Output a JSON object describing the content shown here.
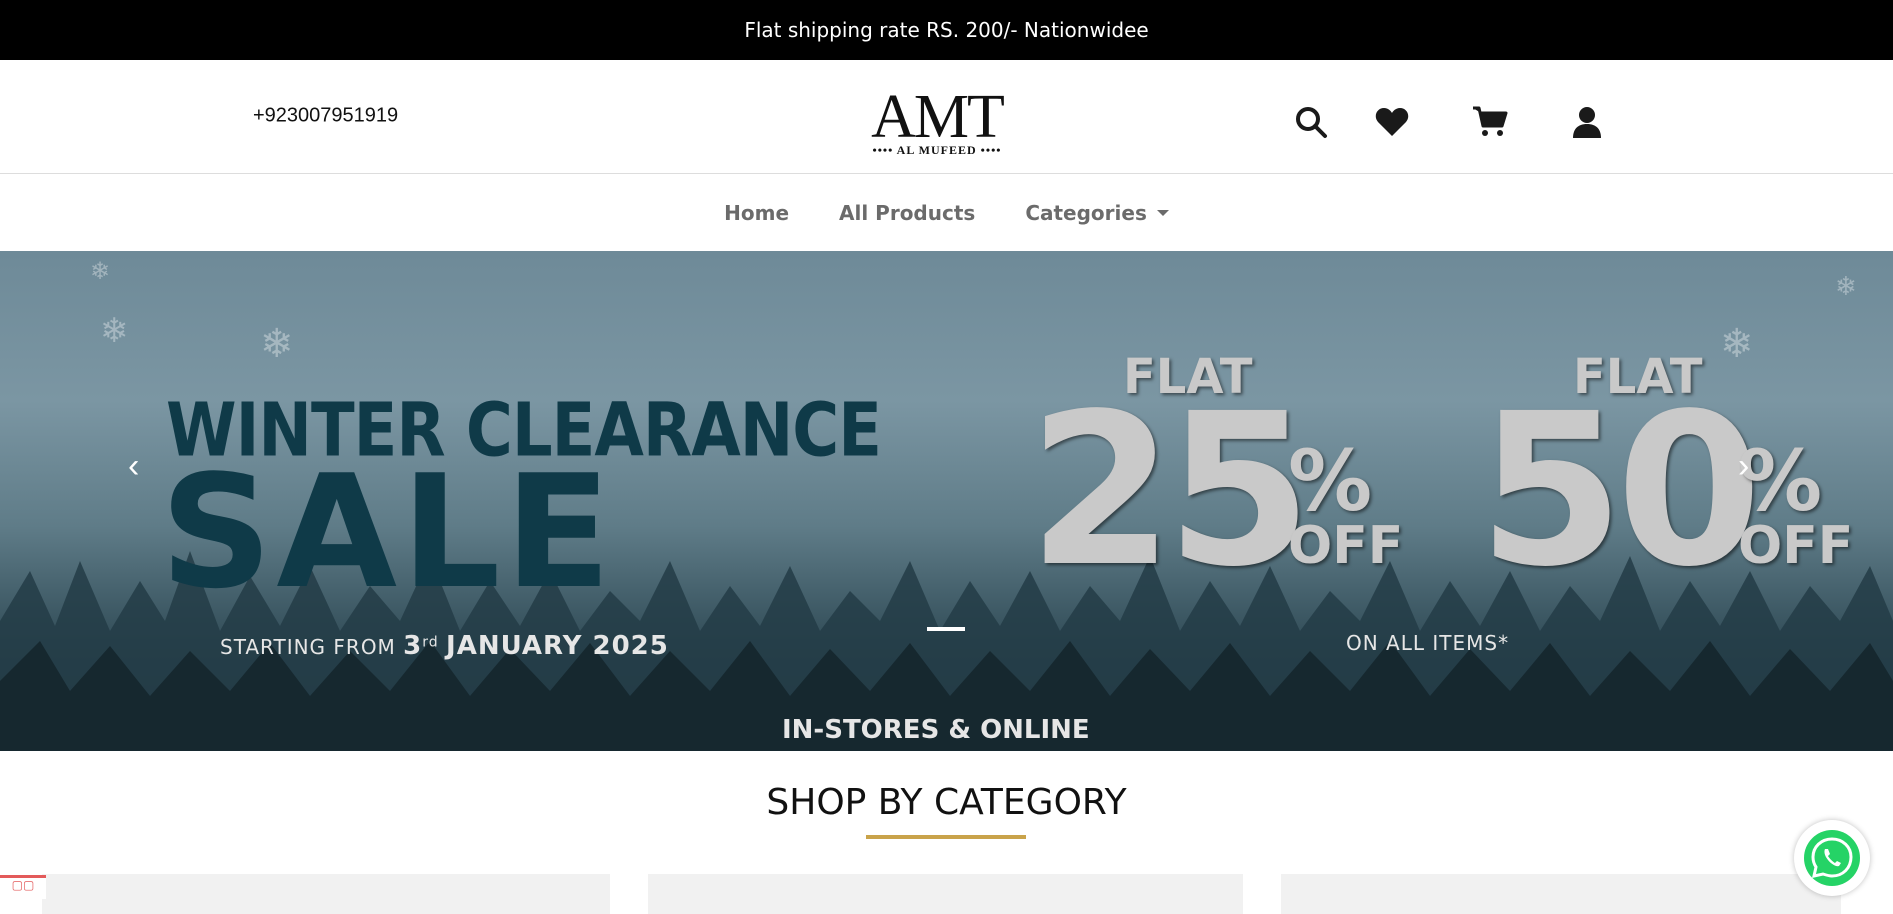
{
  "announcement": "Flat shipping rate RS. 200/- Nationwidee",
  "header": {
    "phone": "+923007951919",
    "logo_mark": "AMT",
    "logo_sub": "•••• AL MUFEED ••••",
    "icons": [
      "search-icon",
      "heart-icon",
      "cart-icon",
      "user-icon"
    ]
  },
  "nav": {
    "home": "Home",
    "all_products": "All Products",
    "categories": "Categories"
  },
  "hero": {
    "line1": "WINTER CLEARANCE",
    "line2": "SALE",
    "starting_prefix": "STARTING FROM",
    "starting_day": "3",
    "starting_suffix": "rd",
    "starting_date": "JANUARY 2025",
    "flat1_word": "FLAT",
    "flat1_num": "25",
    "flat2_word": "FLAT",
    "flat2_num": "50",
    "pct": "%",
    "off": "OFF",
    "on_all": "ON ALL ITEMS*",
    "in_stores": "IN-STORES & ONLINE",
    "prev_glyph": "‹",
    "next_glyph": "›"
  },
  "section": {
    "title": "SHOP BY CATEGORY"
  },
  "colors": {
    "accent_gold": "#c9a34a",
    "sale_teal": "#0f3a48",
    "whatsapp_green": "#25D366"
  }
}
